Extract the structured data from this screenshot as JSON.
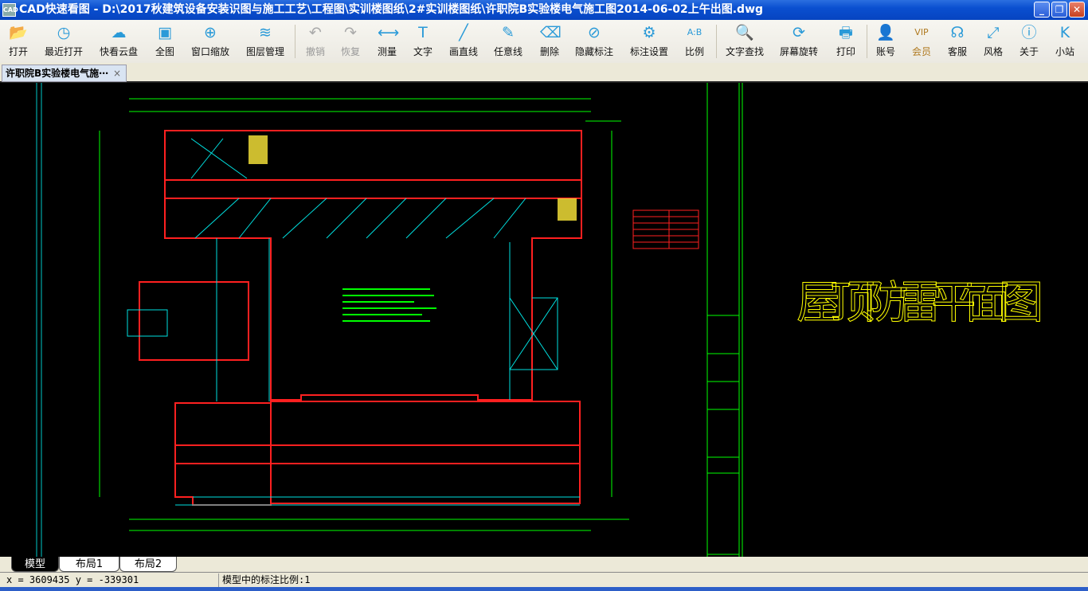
{
  "window": {
    "title": "CAD快速看图 - D:\\2017秋建筑设备安装识图与施工工艺\\工程图\\实训楼图纸\\2#实训楼图纸\\许职院B实验楼电气施工图2014-06-02上午出图.dwg",
    "icon_text": "CAD"
  },
  "toolbar": [
    {
      "label": "打开",
      "icon": "folder-icon",
      "g": "📂"
    },
    {
      "label": "最近打开",
      "icon": "history-icon",
      "g": "◷"
    },
    {
      "label": "快看云盘",
      "icon": "cloud-icon",
      "g": "☁"
    },
    {
      "label": "全图",
      "icon": "fit-all-icon",
      "g": "▣"
    },
    {
      "label": "窗口缩放",
      "icon": "zoom-window-icon",
      "g": "⊕"
    },
    {
      "label": "图层管理",
      "icon": "layers-icon",
      "g": "≋"
    },
    {
      "label": "撤销",
      "icon": "undo-icon",
      "g": "↶"
    },
    {
      "label": "恢复",
      "icon": "redo-icon",
      "g": "↷"
    },
    {
      "label": "测量",
      "icon": "measure-icon",
      "g": "⟷"
    },
    {
      "label": "文字",
      "icon": "text-icon",
      "g": "T"
    },
    {
      "label": "画直线",
      "icon": "line-icon",
      "g": "╱"
    },
    {
      "label": "任意线",
      "icon": "pen-icon",
      "g": "✎"
    },
    {
      "label": "删除",
      "icon": "eraser-icon",
      "g": "⌫"
    },
    {
      "label": "隐藏标注",
      "icon": "hide-eye-icon",
      "g": "⊘"
    },
    {
      "label": "标注设置",
      "icon": "annotation-settings-icon",
      "g": "⚙"
    },
    {
      "label": "比例",
      "icon": "scale-icon",
      "g": "A:B"
    },
    {
      "label": "文字查找",
      "icon": "text-search-icon",
      "g": "🔍"
    },
    {
      "label": "屏幕旋转",
      "icon": "rotate-screen-icon",
      "g": "⟳"
    },
    {
      "label": "打印",
      "icon": "printer-icon",
      "g": "🖶"
    },
    {
      "label": "账号",
      "icon": "user-icon",
      "g": "👤"
    },
    {
      "label": "会员",
      "icon": "vip-icon",
      "g": "VIP"
    },
    {
      "label": "客服",
      "icon": "headset-icon",
      "g": "☊"
    },
    {
      "label": "风格",
      "icon": "style-icon",
      "g": "⤢"
    },
    {
      "label": "关于",
      "icon": "info-icon",
      "g": "ⓘ"
    },
    {
      "label": "小站",
      "icon": "k-logo-icon",
      "g": "K"
    }
  ],
  "doc_tab": {
    "label": "许职院B实验楼电气施⋯",
    "close": "×"
  },
  "drawing": {
    "title": "屋顶防雷平面图"
  },
  "layout_tabs": [
    "模型",
    "布局1",
    "布局2"
  ],
  "status": {
    "coords": "x = 3609435 y = -339301",
    "scale": "模型中的标注比例:1"
  },
  "colors": {
    "title_bar": "#0a4fd0",
    "canvas": "#000000",
    "accent": "#2a9ad8"
  }
}
